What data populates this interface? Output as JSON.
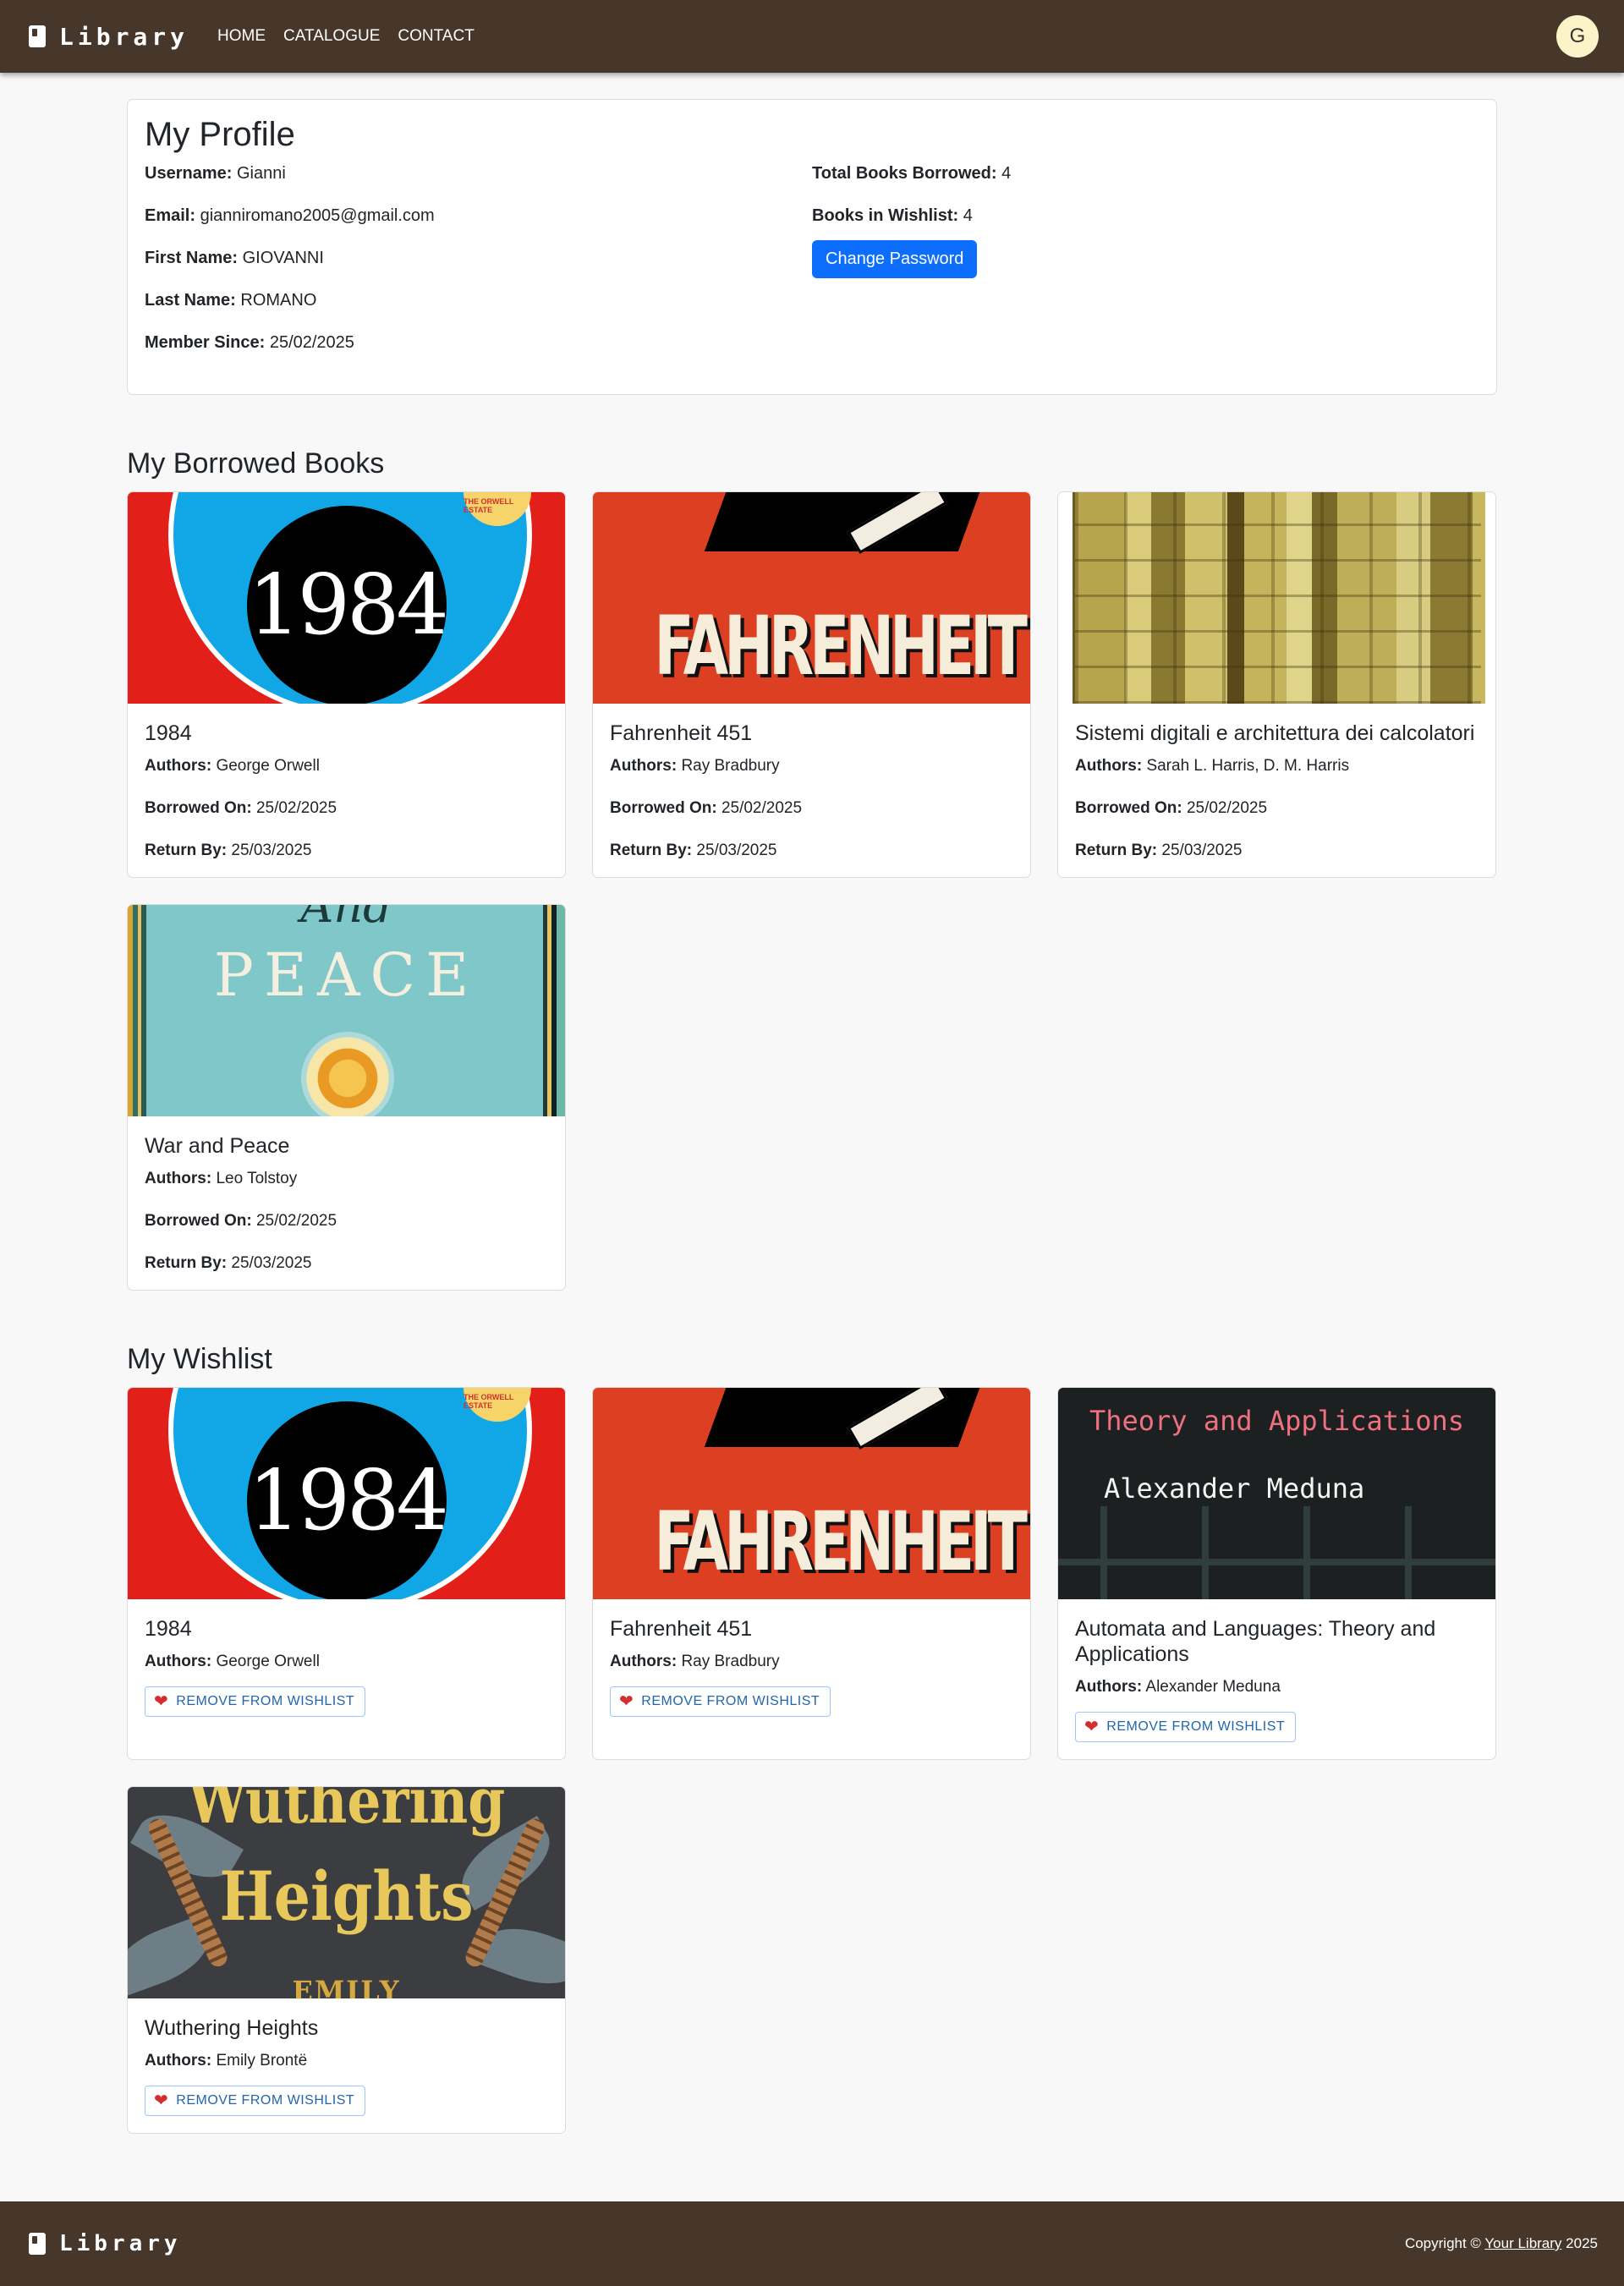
{
  "nav": {
    "brand": "Library",
    "links": [
      "HOME",
      "CATALOGUE",
      "CONTACT"
    ],
    "avatar_initial": "G"
  },
  "profile": {
    "title": "My Profile",
    "fields": [
      {
        "label": "Username:",
        "value": "Gianni"
      },
      {
        "label": "Email:",
        "value": "gianniromano2005@gmail.com"
      },
      {
        "label": "First Name:",
        "value": "GIOVANNI"
      },
      {
        "label": "Last Name:",
        "value": "ROMANO"
      },
      {
        "label": "Member Since:",
        "value": "25/02/2025"
      }
    ],
    "stats": [
      {
        "label": "Total Books Borrowed:",
        "value": "4"
      },
      {
        "label": "Books in Wishlist:",
        "value": "4"
      }
    ],
    "change_password_label": "Change Password"
  },
  "borrowed": {
    "title": "My Borrowed Books",
    "authors_label": "Authors:",
    "borrowed_label": "Borrowed On:",
    "return_label": "Return By:",
    "books": [
      {
        "title": "1984",
        "authors": "George Orwell",
        "borrowed_on": "25/02/2025",
        "return_by": "25/03/2025"
      },
      {
        "title": "Fahrenheit 451",
        "authors": "Ray Bradbury",
        "borrowed_on": "25/02/2025",
        "return_by": "25/03/2025"
      },
      {
        "title": "Sistemi digitali e architettura dei calcolatori",
        "authors": "Sarah L. Harris, D. M. Harris",
        "borrowed_on": "25/02/2025",
        "return_by": "25/03/2025"
      },
      {
        "title": "War and Peace",
        "authors": "Leo Tolstoy",
        "borrowed_on": "25/02/2025",
        "return_by": "25/03/2025"
      }
    ]
  },
  "wishlist": {
    "title": "My Wishlist",
    "authors_label": "Authors:",
    "remove_label": "REMOVE FROM WISHLIST",
    "books": [
      {
        "title": "1984",
        "authors": "George Orwell"
      },
      {
        "title": "Fahrenheit 451",
        "authors": "Ray Bradbury"
      },
      {
        "title": "Automata and Languages: Theory and Applications",
        "authors": "Alexander Meduna"
      },
      {
        "title": "Wuthering Heights",
        "authors": "Emily Brontë"
      }
    ]
  },
  "covers": {
    "c1984": {
      "text": "1984",
      "seal": "THE ORWELL ESTATE"
    },
    "cfahr": {
      "text": "FAHRENHEIT"
    },
    "cwar": {
      "text_top": "And",
      "text": "PEACE"
    },
    "cauto": {
      "line1": "Theory and Applications",
      "line2": "Alexander Meduna"
    },
    "cwuth": {
      "line1": "Wuthering",
      "line2": "Heights",
      "line3": "EMILY"
    }
  },
  "footer": {
    "brand": "Library",
    "copyright_prefix": "Copyright ©",
    "copyright_link": "Your Library",
    "copyright_year": "2025"
  }
}
